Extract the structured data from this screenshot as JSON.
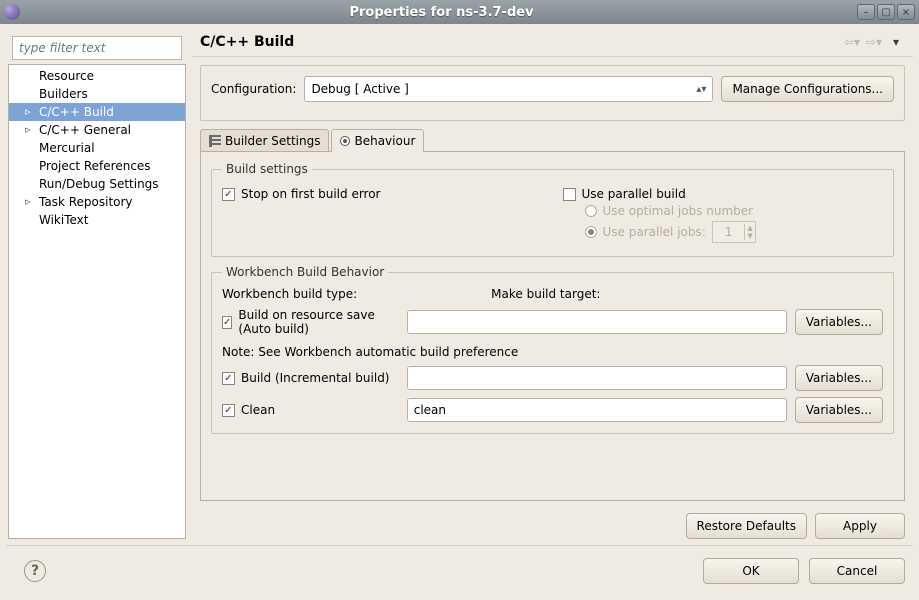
{
  "window": {
    "title": "Properties for ns-3.7-dev"
  },
  "filter_placeholder": "type filter text",
  "tree": {
    "items": [
      {
        "label": "Resource",
        "expandable": false
      },
      {
        "label": "Builders",
        "expandable": false
      },
      {
        "label": "C/C++ Build",
        "expandable": true,
        "selected": true
      },
      {
        "label": "C/C++ General",
        "expandable": true
      },
      {
        "label": "Mercurial",
        "expandable": false
      },
      {
        "label": "Project References",
        "expandable": false
      },
      {
        "label": "Run/Debug Settings",
        "expandable": false
      },
      {
        "label": "Task Repository",
        "expandable": true
      },
      {
        "label": "WikiText",
        "expandable": false
      }
    ]
  },
  "page": {
    "title": "C/C++ Build",
    "configuration_label": "Configuration:",
    "configuration_value": "Debug  [ Active ]",
    "manage_configs": "Manage Configurations...",
    "tabs": {
      "builder_settings": "Builder Settings",
      "behaviour": "Behaviour"
    },
    "build_settings": {
      "legend": "Build settings",
      "stop_on_first": "Stop on first build error",
      "stop_on_first_checked": true,
      "use_parallel": "Use parallel build",
      "use_parallel_checked": false,
      "use_optimal": "Use optimal jobs number",
      "use_parallel_jobs": "Use parallel jobs:",
      "jobs_value": "1"
    },
    "workbench": {
      "legend": "Workbench Build Behavior",
      "build_type_header": "Workbench build type:",
      "make_target_header": "Make build target:",
      "auto_build_label": "Build on resource save (Auto build)",
      "auto_build_checked": true,
      "auto_build_target": "",
      "note": "Note: See Workbench automatic build preference",
      "incremental_label": "Build (Incremental build)",
      "incremental_checked": true,
      "incremental_target": "",
      "clean_label": "Clean",
      "clean_checked": true,
      "clean_target": "clean",
      "variables": "Variables..."
    },
    "restore_defaults": "Restore Defaults",
    "apply": "Apply"
  },
  "buttons": {
    "ok": "OK",
    "cancel": "Cancel"
  }
}
